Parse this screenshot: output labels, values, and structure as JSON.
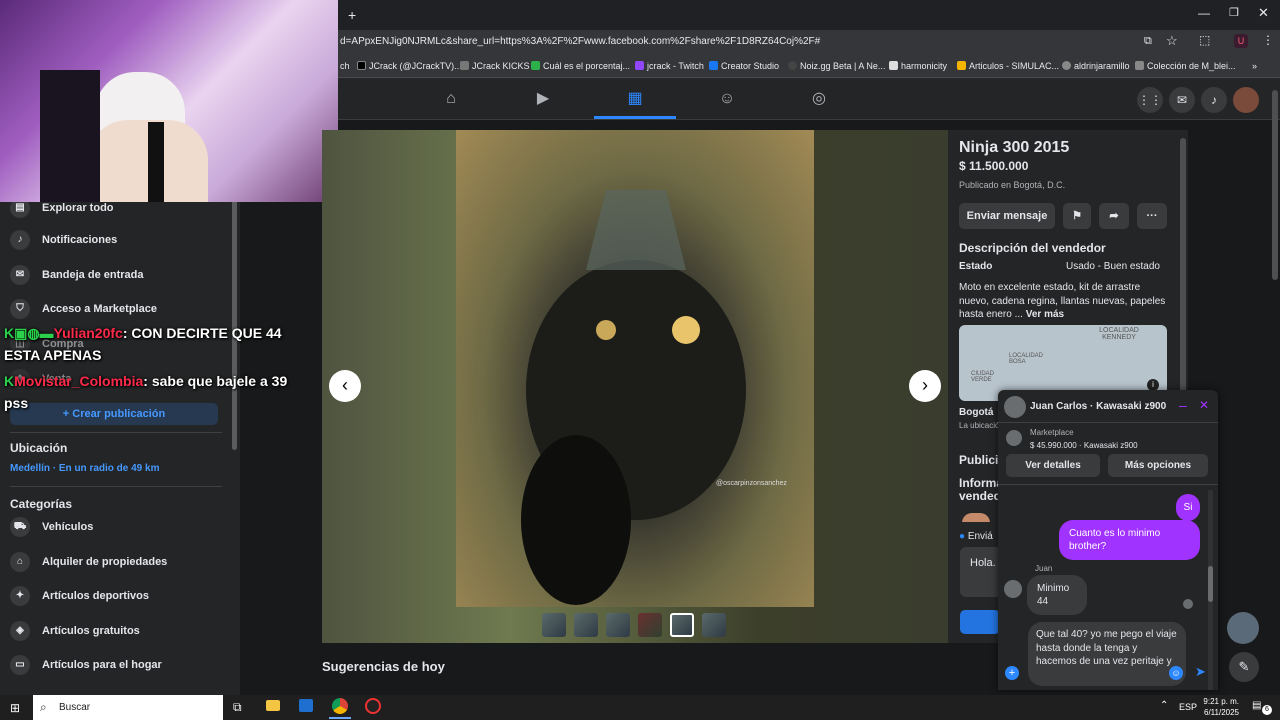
{
  "browser": {
    "new_tab": "+",
    "url": "d=APpxENJig0NJRMLc&share_url=https%3A%2F%2Fwww.facebook.com%2Fshare%2F1D8RZ64Coj%2F#",
    "bookmarks": [
      "ch",
      "JCrack (@JCrackTV)...",
      "JCrack KICKS",
      "Cuál es el porcentaj...",
      "jcrack - Twitch",
      "Creator Studio",
      "Noiz.gg Beta | A Ne...",
      "harmonicity",
      "Articulos - SIMULAC...",
      "aldrinjaramillo",
      "Colección de M_blei..."
    ],
    "more": "»"
  },
  "sidebar": {
    "items_top": [
      "Explorar todo",
      "Notificaciones",
      "Bandeja de entrada",
      "Acceso a Marketplace",
      "Compra",
      "Venta"
    ],
    "create_button": "+ Crear publicación",
    "location_title": "Ubicación",
    "location_value": "Medellín · En un radio de 49 km",
    "categories_title": "Categorías",
    "categories": [
      "Vehículos",
      "Alquiler de propiedades",
      "Artículos deportivos",
      "Artículos gratuitos",
      "Artículos para el hogar"
    ]
  },
  "stream_chat": [
    {
      "user": "Yulian20fc",
      "message": ": CON DECIRTE QUE 44 ESTA APENAS"
    },
    {
      "user": "Movistar_Colombia",
      "message": ": sabe que bajele a 39 pss"
    }
  ],
  "listing": {
    "title": "Ninja 300 2015",
    "price": "$ 11.500.000",
    "published": "Publicado en Bogotá, D.C.",
    "send_message": "Enviar mensaje",
    "desc_title": "Descripción del vendedor",
    "condition_label": "Estado",
    "condition_value": "Usado - Buen estado",
    "description": "Moto en excelente estado, kit de arrastre nuevo, cadena regina, llantas nuevas, papeles hasta enero ...",
    "see_more": "Ver más",
    "map_labels": [
      "LOCALIDAD KENNEDY",
      "LOCALIDAD BOSA",
      "CIUDAD VERDE"
    ],
    "location_city": "Bogotá",
    "location_note": "La ubicación",
    "public_label": "Publicic",
    "info_label": "Informa vended",
    "send_label": "Enviá",
    "hello_text": "Hola.",
    "photo_credit": "@oscarpinzonsanchez"
  },
  "suggestions_title": "Sugerencias de hoy",
  "chat": {
    "header": "Juan Carlos · Kawasaki z900",
    "marketplace_label": "Marketplace",
    "product": "$ 45.990.000 · Kawasaki z900",
    "details_button": "Ver detalles",
    "options_button": "Más opciones",
    "messages": [
      {
        "from": "me",
        "text": "Si"
      },
      {
        "from": "me",
        "text": "Cuanto es lo minimo brother?"
      },
      {
        "from": "them",
        "name": "Juan",
        "text": "Minimo 44"
      }
    ],
    "draft": "Que tal 40? yo me pego el viaje hasta donde la tenga y hacemos de una vez peritaje y"
  },
  "taskbar": {
    "search": "Buscar",
    "lang": "ESP",
    "time": "9:21 p. m.",
    "date": "6/11/2025",
    "notif_count": "6"
  }
}
